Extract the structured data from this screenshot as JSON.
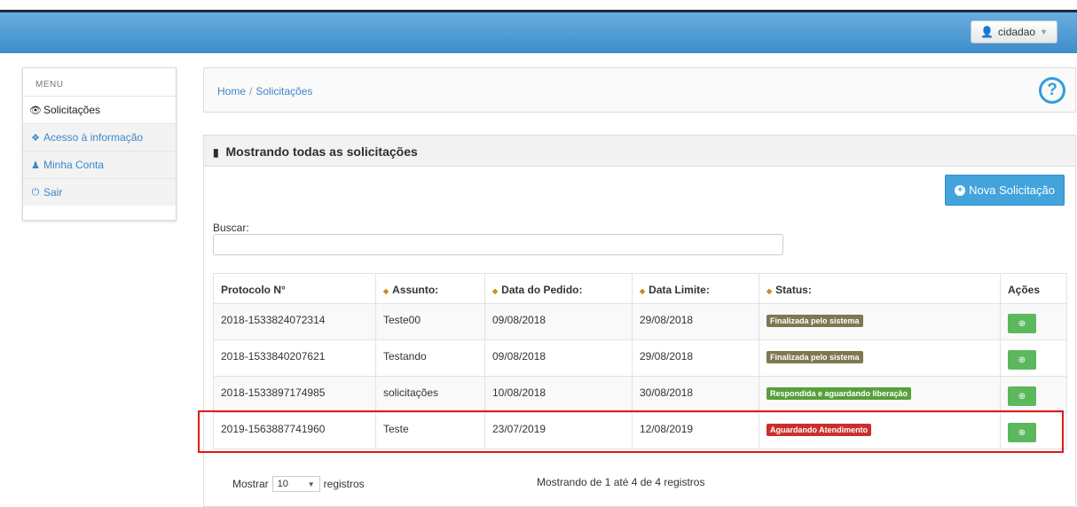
{
  "header": {
    "user_label": "cidadao",
    "user_icon": "user-icon"
  },
  "menu": {
    "title": "MENU",
    "items": [
      {
        "label": "Solicitações",
        "icon": "eye-icon"
      },
      {
        "label": "Acesso à informação",
        "icon": "info-icon"
      },
      {
        "label": "Minha Conta",
        "icon": "user-icon"
      },
      {
        "label": "Sair",
        "icon": "power-icon"
      }
    ]
  },
  "breadcrumb": {
    "home": "Home",
    "current": "Solicitações",
    "help": "?"
  },
  "panel": {
    "title": "Mostrando todas as solicitações",
    "new_button": "Nova Solicitação",
    "search_label": "Buscar:",
    "search_value": ""
  },
  "table": {
    "headers": [
      "Protocolo N°",
      "Assunto:",
      "Data do Pedido:",
      "Data Limite:",
      "Status:",
      "Ações"
    ],
    "rows": [
      {
        "protocolo": "2018-1533824072314",
        "assunto": "Teste00",
        "pedido": "09/08/2018",
        "limite": "29/08/2018",
        "status": "Finalizada pelo sistema",
        "status_color": "#807650"
      },
      {
        "protocolo": "2018-1533840207621",
        "assunto": "Testando",
        "pedido": "09/08/2018",
        "limite": "29/08/2018",
        "status": "Finalizada pelo sistema",
        "status_color": "#807650"
      },
      {
        "protocolo": "2018-1533897174985",
        "assunto": "solicitações",
        "pedido": "10/08/2018",
        "limite": "30/08/2018",
        "status": "Respondida e aguardando liberação",
        "status_color": "#56a03a"
      },
      {
        "protocolo": "2019-1563887741960",
        "assunto": "Teste",
        "pedido": "23/07/2019",
        "limite": "12/08/2019",
        "status": "Aguardando Atendimento",
        "status_color": "#c9302c"
      }
    ]
  },
  "footer": {
    "show_prefix": "Mostrar",
    "page_length": "10",
    "show_suffix": "registros",
    "info": "Mostrando de 1 até 4 de 4 registros"
  },
  "colors": {
    "topbar": "#4a9bd6",
    "accent": "#43a3db",
    "action": "#5cb85c",
    "highlight": "#e0191c"
  }
}
